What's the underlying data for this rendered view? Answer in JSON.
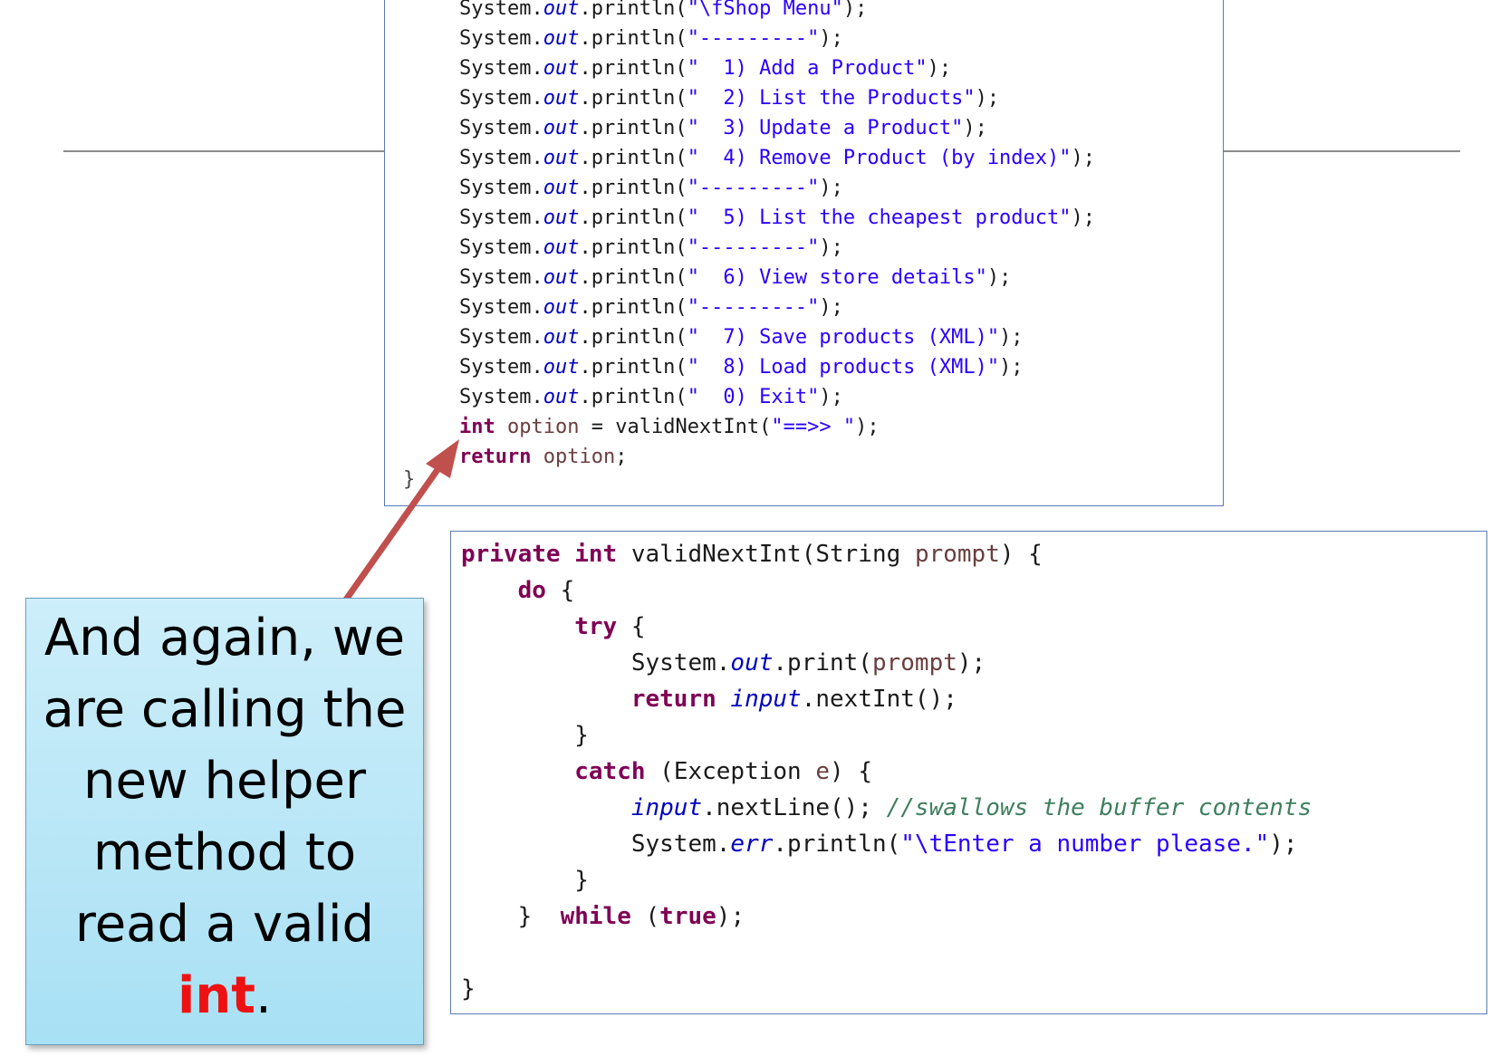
{
  "menu_code": {
    "lines": [
      [
        {
          "t": "System."
        },
        {
          "t": "out",
          "c": "fld"
        },
        {
          "t": ".println("
        },
        {
          "t": "\"\\fShop Menu\"",
          "c": "str"
        },
        {
          "t": ");"
        }
      ],
      [
        {
          "t": "System."
        },
        {
          "t": "out",
          "c": "fld"
        },
        {
          "t": ".println("
        },
        {
          "t": "\"---------\"",
          "c": "str"
        },
        {
          "t": ");"
        }
      ],
      [
        {
          "t": "System."
        },
        {
          "t": "out",
          "c": "fld"
        },
        {
          "t": ".println("
        },
        {
          "t": "\"  1) Add a Product\"",
          "c": "str"
        },
        {
          "t": ");"
        }
      ],
      [
        {
          "t": "System."
        },
        {
          "t": "out",
          "c": "fld"
        },
        {
          "t": ".println("
        },
        {
          "t": "\"  2) List the Products\"",
          "c": "str"
        },
        {
          "t": ");"
        }
      ],
      [
        {
          "t": "System."
        },
        {
          "t": "out",
          "c": "fld"
        },
        {
          "t": ".println("
        },
        {
          "t": "\"  3) Update a Product\"",
          "c": "str"
        },
        {
          "t": ");"
        }
      ],
      [
        {
          "t": "System."
        },
        {
          "t": "out",
          "c": "fld"
        },
        {
          "t": ".println("
        },
        {
          "t": "\"  4) Remove Product (by index)\"",
          "c": "str"
        },
        {
          "t": ");"
        }
      ],
      [
        {
          "t": "System."
        },
        {
          "t": "out",
          "c": "fld"
        },
        {
          "t": ".println("
        },
        {
          "t": "\"---------\"",
          "c": "str"
        },
        {
          "t": ");"
        }
      ],
      [
        {
          "t": "System."
        },
        {
          "t": "out",
          "c": "fld"
        },
        {
          "t": ".println("
        },
        {
          "t": "\"  5) List the cheapest product\"",
          "c": "str"
        },
        {
          "t": ");"
        }
      ],
      [
        {
          "t": "System."
        },
        {
          "t": "out",
          "c": "fld"
        },
        {
          "t": ".println("
        },
        {
          "t": "\"---------\"",
          "c": "str"
        },
        {
          "t": ");"
        }
      ],
      [
        {
          "t": "System."
        },
        {
          "t": "out",
          "c": "fld"
        },
        {
          "t": ".println("
        },
        {
          "t": "\"  6) View store details\"",
          "c": "str"
        },
        {
          "t": ");"
        }
      ],
      [
        {
          "t": "System."
        },
        {
          "t": "out",
          "c": "fld"
        },
        {
          "t": ".println("
        },
        {
          "t": "\"---------\"",
          "c": "str"
        },
        {
          "t": ");"
        }
      ],
      [
        {
          "t": "System."
        },
        {
          "t": "out",
          "c": "fld"
        },
        {
          "t": ".println("
        },
        {
          "t": "\"  7) Save products (XML)\"",
          "c": "str"
        },
        {
          "t": ");"
        }
      ],
      [
        {
          "t": "System."
        },
        {
          "t": "out",
          "c": "fld"
        },
        {
          "t": ".println("
        },
        {
          "t": "\"  8) Load products (XML)\"",
          "c": "str"
        },
        {
          "t": ");"
        }
      ],
      [
        {
          "t": "System."
        },
        {
          "t": "out",
          "c": "fld"
        },
        {
          "t": ".println("
        },
        {
          "t": "\"  0) Exit\"",
          "c": "str"
        },
        {
          "t": ");"
        }
      ],
      [
        {
          "t": "int",
          "c": "kw"
        },
        {
          "t": " "
        },
        {
          "t": "option",
          "c": "var"
        },
        {
          "t": " = validNextInt("
        },
        {
          "t": "\"==>> \"",
          "c": "str"
        },
        {
          "t": ");"
        }
      ],
      [
        {
          "t": "return",
          "c": "kw"
        },
        {
          "t": " "
        },
        {
          "t": "option",
          "c": "var"
        },
        {
          "t": ";"
        }
      ]
    ],
    "closing_brace": "}"
  },
  "helper_code": {
    "lines": [
      [
        {
          "t": "private",
          "c": "kw"
        },
        {
          "t": " "
        },
        {
          "t": "int",
          "c": "kw"
        },
        {
          "t": " validNextInt(String "
        },
        {
          "t": "prompt",
          "c": "var"
        },
        {
          "t": ") {"
        }
      ],
      [
        {
          "t": "    "
        },
        {
          "t": "do",
          "c": "kw"
        },
        {
          "t": " {"
        }
      ],
      [
        {
          "t": "        "
        },
        {
          "t": "try",
          "c": "kw"
        },
        {
          "t": " {"
        }
      ],
      [
        {
          "t": "            System."
        },
        {
          "t": "out",
          "c": "fld"
        },
        {
          "t": ".print("
        },
        {
          "t": "prompt",
          "c": "var"
        },
        {
          "t": ");"
        }
      ],
      [
        {
          "t": "            "
        },
        {
          "t": "return",
          "c": "kw"
        },
        {
          "t": " "
        },
        {
          "t": "input",
          "c": "fld"
        },
        {
          "t": ".nextInt();"
        }
      ],
      [
        {
          "t": "        }"
        }
      ],
      [
        {
          "t": "        "
        },
        {
          "t": "catch",
          "c": "kw"
        },
        {
          "t": " (Exception "
        },
        {
          "t": "e",
          "c": "var"
        },
        {
          "t": ") {"
        }
      ],
      [
        {
          "t": "            "
        },
        {
          "t": "input",
          "c": "fld"
        },
        {
          "t": ".nextLine(); "
        },
        {
          "t": "//swallows the buffer contents",
          "c": "cmt"
        }
      ],
      [
        {
          "t": "            System."
        },
        {
          "t": "err",
          "c": "fld"
        },
        {
          "t": ".println("
        },
        {
          "t": "\"\\tEnter a number please.\"",
          "c": "str"
        },
        {
          "t": ");"
        }
      ],
      [
        {
          "t": "        }"
        }
      ],
      [
        {
          "t": "    }  "
        },
        {
          "t": "while",
          "c": "kw"
        },
        {
          "t": " ("
        },
        {
          "t": "true",
          "c": "kw"
        },
        {
          "t": ");"
        }
      ],
      [
        {
          "t": ""
        }
      ],
      [
        {
          "t": "}"
        }
      ]
    ]
  },
  "callout": {
    "lines": [
      "And again, we",
      "are calling the",
      "new helper",
      "method to",
      "read a valid"
    ],
    "highlight": "int",
    "suffix": "."
  }
}
